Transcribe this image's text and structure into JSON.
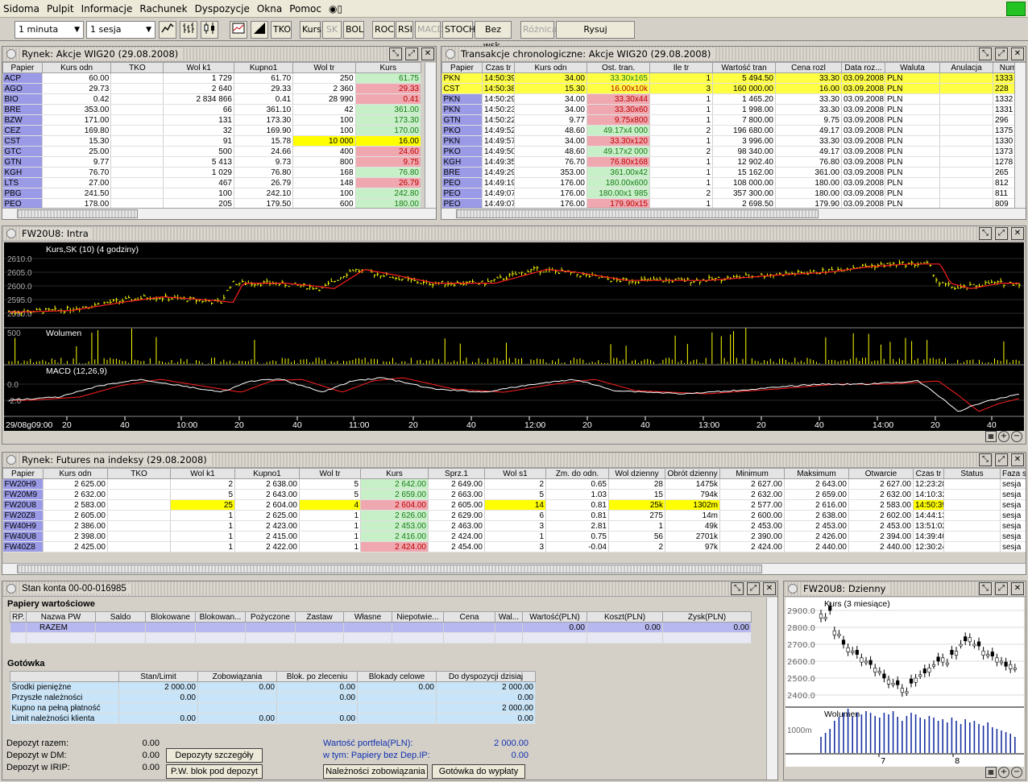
{
  "menu": [
    "Sidoma",
    "Pulpit",
    "Informacje",
    "Rachunek",
    "Dyspozycje",
    "Okna",
    "Pomoc"
  ],
  "toolbar": {
    "interval": "1 minuta",
    "session": "1 sesja",
    "buttons": [
      "TKO",
      "Kurs",
      "SK",
      "BOL",
      "ROC",
      "RSI",
      "MACD",
      "STOCH",
      "Bez wsk.",
      "Różnica",
      "Rysuj"
    ]
  },
  "wig20": {
    "title": "Rynek: Akcje WIG20 (29.08.2008)",
    "cols": [
      "Papier",
      "Kurs odn",
      "TKO",
      "Wol k1",
      "Kupno1",
      "Wol tr",
      "Kurs"
    ],
    "rows": [
      [
        "ACP",
        "60.00",
        "",
        "1 729",
        "61.70",
        "250",
        "61.75"
      ],
      [
        "AGO",
        "29.73",
        "",
        "2 640",
        "29.33",
        "2 360",
        "29.33"
      ],
      [
        "BIO",
        "0.42",
        "",
        "2 834 866",
        "0.41",
        "28 990",
        "0.41"
      ],
      [
        "BRE",
        "353.00",
        "",
        "66",
        "361.10",
        "42",
        "361.00"
      ],
      [
        "BZW",
        "171.00",
        "",
        "131",
        "173.30",
        "100",
        "173.30"
      ],
      [
        "CEZ",
        "169.80",
        "",
        "32",
        "169.90",
        "100",
        "170.00"
      ],
      [
        "CST",
        "15.30",
        "",
        "91",
        "15.78",
        "10 000",
        "16.00"
      ],
      [
        "GTC",
        "25.00",
        "",
        "500",
        "24.66",
        "400",
        "24.60"
      ],
      [
        "GTN",
        "9.77",
        "",
        "5 413",
        "9.73",
        "800",
        "9.75"
      ],
      [
        "KGH",
        "76.70",
        "",
        "1 029",
        "76.80",
        "168",
        "76.80"
      ],
      [
        "LTS",
        "27.00",
        "",
        "467",
        "26.79",
        "148",
        "26.79"
      ],
      [
        "PBG",
        "241.50",
        "",
        "100",
        "242.10",
        "100",
        "242.80"
      ],
      [
        "PEO",
        "178.00",
        "",
        "205",
        "179.50",
        "600",
        "180.00"
      ]
    ]
  },
  "trans": {
    "title": "Transakcje chronologiczne: Akcje WIG20 (29.08.2008)",
    "cols": [
      "Papier",
      "Czas tr",
      "Kurs odn",
      "Ost. tran.",
      "Ile tr",
      "Wartość tran",
      "Cena rozl",
      "Data roz...",
      "Waluta",
      "Anulacja",
      "Numer t"
    ],
    "rows": [
      [
        "PKN",
        "14:50:39",
        "34.00",
        "33.30x165",
        "1",
        "5 494.50",
        "33.30",
        "03.09.2008",
        "PLN",
        "",
        "1333"
      ],
      [
        "CST",
        "14:50:38",
        "15.30",
        "16.00x10k",
        "3",
        "160 000.00",
        "16.00",
        "03.09.2008",
        "PLN",
        "",
        "228"
      ],
      [
        "PKN",
        "14:50:29",
        "34.00",
        "33.30x44",
        "1",
        "1 465.20",
        "33.30",
        "03.09.2008",
        "PLN",
        "",
        "1332"
      ],
      [
        "PKN",
        "14:50:23",
        "34.00",
        "33.30x60",
        "1",
        "1 998.00",
        "33.30",
        "03.09.2008",
        "PLN",
        "",
        "1331"
      ],
      [
        "GTN",
        "14:50:22",
        "9.77",
        "9.75x800",
        "1",
        "7 800.00",
        "9.75",
        "03.09.2008",
        "PLN",
        "",
        "296"
      ],
      [
        "PKO",
        "14:49:52",
        "48.60",
        "49.17x4 000",
        "2",
        "196 680.00",
        "49.17",
        "03.09.2008",
        "PLN",
        "",
        "1375"
      ],
      [
        "PKN",
        "14:49:57",
        "34.00",
        "33.30x120",
        "1",
        "3 996.00",
        "33.30",
        "03.09.2008",
        "PLN",
        "",
        "1330"
      ],
      [
        "PKO",
        "14:49:50",
        "48.60",
        "49.17x2 000",
        "2",
        "98 340.00",
        "49.17",
        "03.09.2008",
        "PLN",
        "",
        "1373"
      ],
      [
        "KGH",
        "14:49:35",
        "76.70",
        "76.80x168",
        "1",
        "12 902.40",
        "76.80",
        "03.09.2008",
        "PLN",
        "",
        "1278"
      ],
      [
        "BRE",
        "14:49:29",
        "353.00",
        "361.00x42",
        "1",
        "15 162.00",
        "361.00",
        "03.09.2008",
        "PLN",
        "",
        "265"
      ],
      [
        "PEO",
        "14:49:19",
        "176.00",
        "180.00x600",
        "1",
        "108 000.00",
        "180.00",
        "03.09.2008",
        "PLN",
        "",
        "812"
      ],
      [
        "PEO",
        "14:49:07",
        "176.00",
        "180.00x1 985",
        "2",
        "357 300.00",
        "180.00",
        "03.09.2008",
        "PLN",
        "",
        "811"
      ],
      [
        "PEO",
        "14:49:07",
        "176.00",
        "179.90x15",
        "1",
        "2 698.50",
        "179.90",
        "03.09.2008",
        "PLN",
        "",
        "809"
      ]
    ]
  },
  "intra": {
    "title": "FW20U8: Intra",
    "price_label": "Kurs,SK (10) (4 godziny)",
    "price_ticks": [
      "2610.0",
      "2605.0",
      "2600.0",
      "2595.0",
      "2590.0"
    ],
    "volume_label": "Wolumen",
    "volume_tick": "500",
    "macd_label": "MACD (12,26,9)",
    "macd_ticks": [
      "0.0",
      "-2.0"
    ],
    "time_labels": [
      "29/08g09:00",
      "20",
      "40",
      "10:00",
      "20",
      "40",
      "11:00",
      "20",
      "40",
      "12:00",
      "20",
      "40",
      "13:00",
      "20",
      "40",
      "14:00",
      "20",
      "40"
    ]
  },
  "futures": {
    "title": "Rynek: Futures na indeksy (29.08.2008)",
    "cols": [
      "Papier",
      "Kurs odn",
      "TKO",
      "Wol k1",
      "Kupno1",
      "Wol tr",
      "Kurs",
      "Sprz.1",
      "Wol s1",
      "Zm. do odn.",
      "Wol dzienny",
      "Obrót dzienny",
      "Minimum",
      "Maksimum",
      "Otwarcie",
      "Czas tr",
      "Status",
      "Faza s"
    ],
    "rows": [
      [
        "FW20H9",
        "2 625.00",
        "",
        "2",
        "2 638.00",
        "5",
        "2 642.00",
        "2 649.00",
        "2",
        "0.65",
        "28",
        "1475k",
        "2 627.00",
        "2 643.00",
        "2 627.00",
        "12:23:28",
        "",
        "sesja"
      ],
      [
        "FW20M9",
        "2 632.00",
        "",
        "5",
        "2 643.00",
        "5",
        "2 659.00",
        "2 663.00",
        "5",
        "1.03",
        "15",
        "794k",
        "2 632.00",
        "2 659.00",
        "2 632.00",
        "14:10:32",
        "",
        "sesja"
      ],
      [
        "FW20U8",
        "2 583.00",
        "",
        "25",
        "2 604.00",
        "4",
        "2 604.00",
        "2 605.00",
        "14",
        "0.81",
        "25k",
        "1302m",
        "2 577.00",
        "2 616.00",
        "2 583.00",
        "14:50:39",
        "",
        "sesja"
      ],
      [
        "FW20Z8",
        "2 605.00",
        "",
        "1",
        "2 625.00",
        "1",
        "2 626.00",
        "2 629.00",
        "6",
        "0.81",
        "275",
        "14m",
        "2 600.00",
        "2 638.00",
        "2 602.00",
        "14:44:13",
        "",
        "sesja"
      ],
      [
        "FW40H9",
        "2 386.00",
        "",
        "1",
        "2 423.00",
        "1",
        "2 453.00",
        "2 463.00",
        "3",
        "2.81",
        "1",
        "49k",
        "2 453.00",
        "2 453.00",
        "2 453.00",
        "13:51:02",
        "",
        "sesja"
      ],
      [
        "FW40U8",
        "2 398.00",
        "",
        "1",
        "2 415.00",
        "1",
        "2 416.00",
        "2 424.00",
        "1",
        "0.75",
        "56",
        "2701k",
        "2 390.00",
        "2 426.00",
        "2 394.00",
        "14:39:40",
        "",
        "sesja"
      ],
      [
        "FW40Z8",
        "2 425.00",
        "",
        "1",
        "2 422.00",
        "1",
        "2 424.00",
        "2 454.00",
        "3",
        "-0.04",
        "2",
        "97k",
        "2 424.00",
        "2 440.00",
        "2 440.00",
        "12:30:24",
        "",
        "sesja"
      ]
    ]
  },
  "account": {
    "title": "Stan konta 00-00-016985",
    "securities_title": "Papiery wartościowe",
    "sec_cols": [
      "RP.",
      "Nazwa PW",
      "Saldo",
      "Blokowane",
      "Blokowan...",
      "Pożyczone",
      "Zastaw",
      "Własne",
      "Niepotwie...",
      "Cena",
      "Wal...",
      "Wartość(PLN)",
      "Koszt(PLN)",
      "Zysk(PLN)"
    ],
    "sec_row": [
      "",
      "RAZEM",
      "",
      "",
      "",
      "",
      "",
      "",
      "",
      "",
      "",
      "0.00",
      "0.00",
      "0.00"
    ],
    "cash_title": "Gotówka",
    "cash_cols": [
      "",
      "Stan/Limit",
      "Zobowiązania",
      "Blok. po zleceniu",
      "Blokady celowe",
      "Do dyspozycji dzisiaj"
    ],
    "cash_rows": [
      [
        "Środki pieniężne",
        "2 000.00",
        "0.00",
        "0.00",
        "0.00",
        "2 000.00"
      ],
      [
        "Przyszłe należności",
        "0.00",
        "",
        "0.00",
        "",
        "0.00"
      ],
      [
        "Kupno na pełną płatność",
        "",
        "",
        "",
        "",
        "2 000.00"
      ],
      [
        "Limit należności klienta",
        "0.00",
        "0.00",
        "0.00",
        "",
        "0.00"
      ]
    ],
    "deposit_total_label": "Depozyt razem:",
    "deposit_total": "0.00",
    "deposit_dm_label": "Depozyt w DM:",
    "deposit_dm": "0.00",
    "deposit_irip_label": "Depozyt w IRIP:",
    "deposit_irip": "0.00",
    "btn_deposits": "Depozyty szczegóły",
    "btn_pw_blok": "P.W. blok pod depozyt",
    "portfolio_label": "Wartość portfela(PLN):",
    "portfolio_value": "2 000.00",
    "nondep_label": "w tym: Papiery bez Dep.IP:",
    "nondep_value": "0.00",
    "btn_naleznosci": "Należności zobowiązania",
    "btn_gotowka": "Gotówka do wypłaty"
  },
  "daily": {
    "title": "FW20U8: Dzienny",
    "price_label": "Kurs (3 miesiące)",
    "price_ticks": [
      "2900.0",
      "2800.0",
      "2700.0",
      "2600.0",
      "2500.0",
      "2400.0"
    ],
    "volume_label": "Wolumen",
    "volume_tick": "1000m",
    "x_labels": [
      "7",
      "8"
    ]
  }
}
